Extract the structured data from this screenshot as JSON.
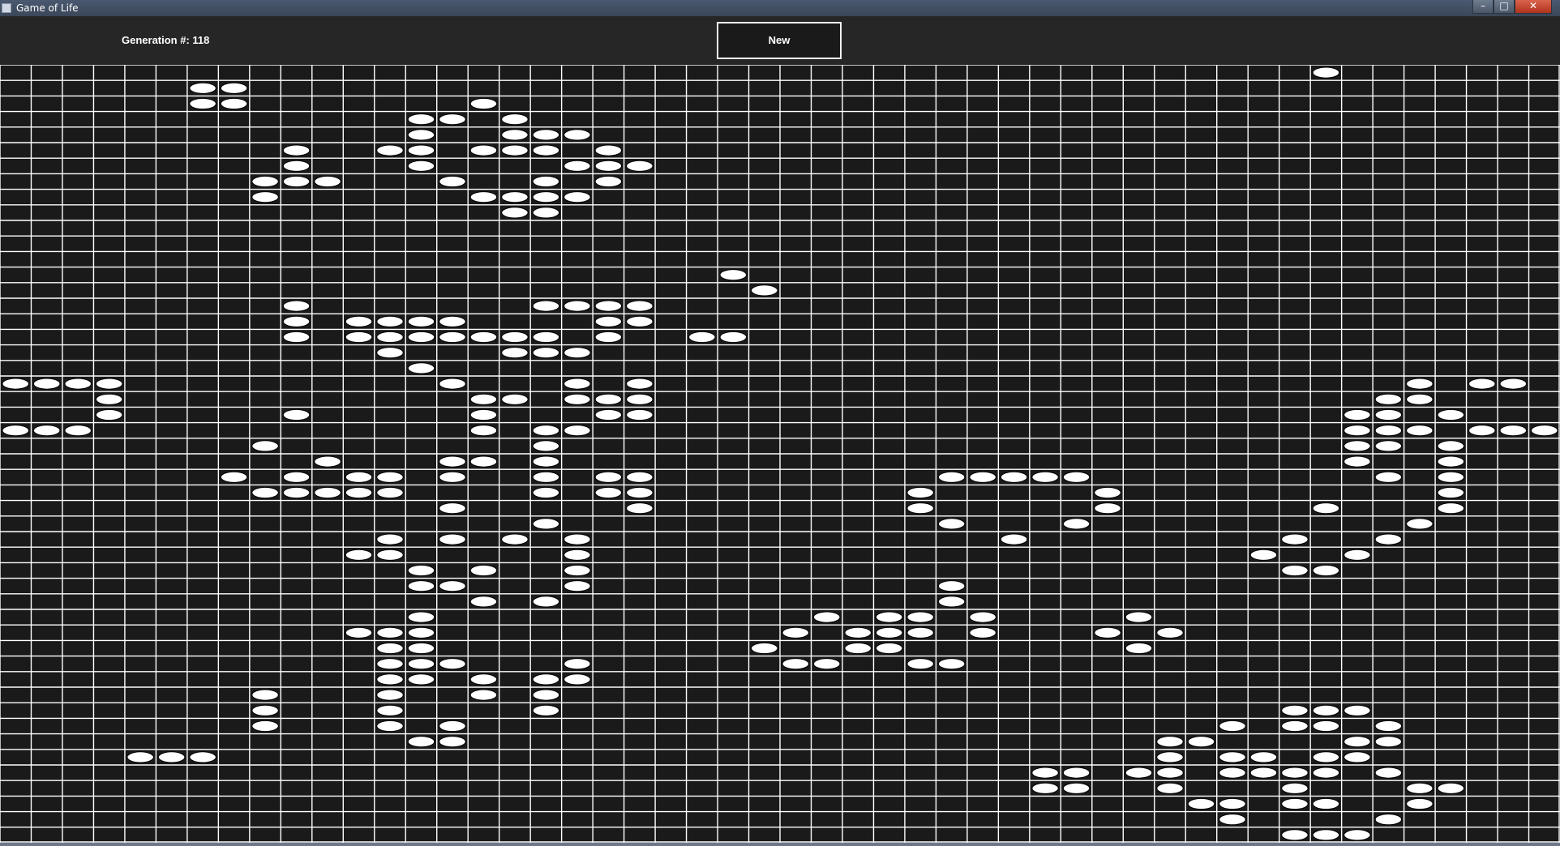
{
  "window": {
    "title": "Game of Life",
    "controls": {
      "minimize": "–",
      "maximize": "□",
      "close": "✕"
    }
  },
  "toolbar": {
    "generation_label": "Generation #: 118",
    "new_button_label": "New"
  },
  "board": {
    "columns": 50,
    "rows": 50,
    "background_color": "#1a1a1a",
    "grid_color": "#ffffff",
    "live_cell_color": "#ffffff",
    "live_cells": [
      [
        0,
        42
      ],
      [
        1,
        6
      ],
      [
        1,
        7
      ],
      [
        2,
        6
      ],
      [
        2,
        7
      ],
      [
        2,
        15
      ],
      [
        3,
        13
      ],
      [
        3,
        14
      ],
      [
        3,
        16
      ],
      [
        4,
        13
      ],
      [
        4,
        16
      ],
      [
        4,
        17
      ],
      [
        4,
        18
      ],
      [
        5,
        9
      ],
      [
        5,
        12
      ],
      [
        5,
        13
      ],
      [
        5,
        15
      ],
      [
        5,
        16
      ],
      [
        5,
        17
      ],
      [
        5,
        19
      ],
      [
        6,
        9
      ],
      [
        6,
        13
      ],
      [
        6,
        18
      ],
      [
        6,
        19
      ],
      [
        6,
        20
      ],
      [
        7,
        8
      ],
      [
        7,
        9
      ],
      [
        7,
        10
      ],
      [
        7,
        14
      ],
      [
        7,
        17
      ],
      [
        7,
        19
      ],
      [
        8,
        8
      ],
      [
        8,
        15
      ],
      [
        8,
        16
      ],
      [
        8,
        17
      ],
      [
        8,
        18
      ],
      [
        9,
        16
      ],
      [
        9,
        17
      ],
      [
        13,
        23
      ],
      [
        14,
        24
      ],
      [
        15,
        9
      ],
      [
        15,
        17
      ],
      [
        15,
        18
      ],
      [
        15,
        19
      ],
      [
        15,
        20
      ],
      [
        16,
        9
      ],
      [
        16,
        11
      ],
      [
        16,
        12
      ],
      [
        16,
        13
      ],
      [
        16,
        14
      ],
      [
        16,
        19
      ],
      [
        16,
        20
      ],
      [
        17,
        9
      ],
      [
        17,
        11
      ],
      [
        17,
        12
      ],
      [
        17,
        13
      ],
      [
        17,
        14
      ],
      [
        17,
        15
      ],
      [
        17,
        16
      ],
      [
        17,
        17
      ],
      [
        17,
        19
      ],
      [
        17,
        22
      ],
      [
        17,
        23
      ],
      [
        18,
        12
      ],
      [
        18,
        16
      ],
      [
        18,
        17
      ],
      [
        18,
        18
      ],
      [
        19,
        13
      ],
      [
        20,
        0
      ],
      [
        20,
        1
      ],
      [
        20,
        2
      ],
      [
        20,
        3
      ],
      [
        20,
        14
      ],
      [
        20,
        18
      ],
      [
        20,
        20
      ],
      [
        20,
        45
      ],
      [
        20,
        47
      ],
      [
        20,
        48
      ],
      [
        21,
        3
      ],
      [
        21,
        15
      ],
      [
        21,
        16
      ],
      [
        21,
        18
      ],
      [
        21,
        19
      ],
      [
        21,
        20
      ],
      [
        21,
        44
      ],
      [
        21,
        45
      ],
      [
        22,
        3
      ],
      [
        22,
        9
      ],
      [
        22,
        15
      ],
      [
        22,
        19
      ],
      [
        22,
        20
      ],
      [
        22,
        43
      ],
      [
        22,
        44
      ],
      [
        22,
        46
      ],
      [
        23,
        0
      ],
      [
        23,
        1
      ],
      [
        23,
        2
      ],
      [
        23,
        15
      ],
      [
        23,
        17
      ],
      [
        23,
        18
      ],
      [
        23,
        43
      ],
      [
        23,
        44
      ],
      [
        23,
        45
      ],
      [
        23,
        47
      ],
      [
        23,
        48
      ],
      [
        23,
        49
      ],
      [
        24,
        8
      ],
      [
        24,
        17
      ],
      [
        24,
        43
      ],
      [
        24,
        44
      ],
      [
        24,
        46
      ],
      [
        25,
        10
      ],
      [
        25,
        14
      ],
      [
        25,
        15
      ],
      [
        25,
        17
      ],
      [
        25,
        43
      ],
      [
        25,
        46
      ],
      [
        26,
        7
      ],
      [
        26,
        9
      ],
      [
        26,
        11
      ],
      [
        26,
        12
      ],
      [
        26,
        14
      ],
      [
        26,
        17
      ],
      [
        26,
        19
      ],
      [
        26,
        20
      ],
      [
        26,
        30
      ],
      [
        26,
        31
      ],
      [
        26,
        32
      ],
      [
        26,
        33
      ],
      [
        26,
        34
      ],
      [
        26,
        44
      ],
      [
        26,
        46
      ],
      [
        27,
        8
      ],
      [
        27,
        9
      ],
      [
        27,
        10
      ],
      [
        27,
        11
      ],
      [
        27,
        12
      ],
      [
        27,
        17
      ],
      [
        27,
        19
      ],
      [
        27,
        20
      ],
      [
        27,
        29
      ],
      [
        27,
        35
      ],
      [
        27,
        46
      ],
      [
        28,
        14
      ],
      [
        28,
        20
      ],
      [
        28,
        29
      ],
      [
        28,
        35
      ],
      [
        28,
        42
      ],
      [
        28,
        46
      ],
      [
        29,
        17
      ],
      [
        29,
        30
      ],
      [
        29,
        34
      ],
      [
        29,
        45
      ],
      [
        30,
        12
      ],
      [
        30,
        14
      ],
      [
        30,
        16
      ],
      [
        30,
        18
      ],
      [
        30,
        32
      ],
      [
        30,
        41
      ],
      [
        30,
        44
      ],
      [
        31,
        11
      ],
      [
        31,
        12
      ],
      [
        31,
        18
      ],
      [
        31,
        40
      ],
      [
        31,
        43
      ],
      [
        32,
        13
      ],
      [
        32,
        15
      ],
      [
        32,
        18
      ],
      [
        32,
        41
      ],
      [
        32,
        42
      ],
      [
        33,
        13
      ],
      [
        33,
        14
      ],
      [
        33,
        18
      ],
      [
        33,
        30
      ],
      [
        34,
        15
      ],
      [
        34,
        17
      ],
      [
        34,
        30
      ],
      [
        35,
        13
      ],
      [
        35,
        26
      ],
      [
        35,
        28
      ],
      [
        35,
        29
      ],
      [
        35,
        31
      ],
      [
        35,
        36
      ],
      [
        36,
        11
      ],
      [
        36,
        12
      ],
      [
        36,
        13
      ],
      [
        36,
        25
      ],
      [
        36,
        27
      ],
      [
        36,
        28
      ],
      [
        36,
        29
      ],
      [
        36,
        31
      ],
      [
        36,
        35
      ],
      [
        36,
        37
      ],
      [
        37,
        12
      ],
      [
        37,
        13
      ],
      [
        37,
        24
      ],
      [
        37,
        27
      ],
      [
        37,
        28
      ],
      [
        37,
        36
      ],
      [
        38,
        12
      ],
      [
        38,
        13
      ],
      [
        38,
        14
      ],
      [
        38,
        18
      ],
      [
        38,
        25
      ],
      [
        38,
        26
      ],
      [
        38,
        29
      ],
      [
        38,
        30
      ],
      [
        39,
        12
      ],
      [
        39,
        13
      ],
      [
        39,
        15
      ],
      [
        39,
        17
      ],
      [
        39,
        18
      ],
      [
        40,
        8
      ],
      [
        40,
        12
      ],
      [
        40,
        15
      ],
      [
        40,
        17
      ],
      [
        41,
        8
      ],
      [
        41,
        12
      ],
      [
        41,
        17
      ],
      [
        41,
        41
      ],
      [
        41,
        42
      ],
      [
        41,
        43
      ],
      [
        42,
        8
      ],
      [
        42,
        12
      ],
      [
        42,
        14
      ],
      [
        42,
        39
      ],
      [
        42,
        41
      ],
      [
        42,
        42
      ],
      [
        42,
        44
      ],
      [
        43,
        13
      ],
      [
        43,
        14
      ],
      [
        43,
        37
      ],
      [
        43,
        38
      ],
      [
        43,
        43
      ],
      [
        43,
        44
      ],
      [
        44,
        4
      ],
      [
        44,
        5
      ],
      [
        44,
        6
      ],
      [
        44,
        37
      ],
      [
        44,
        39
      ],
      [
        44,
        40
      ],
      [
        44,
        42
      ],
      [
        44,
        43
      ],
      [
        45,
        33
      ],
      [
        45,
        34
      ],
      [
        45,
        36
      ],
      [
        45,
        37
      ],
      [
        45,
        39
      ],
      [
        45,
        40
      ],
      [
        45,
        41
      ],
      [
        45,
        42
      ],
      [
        45,
        44
      ],
      [
        46,
        33
      ],
      [
        46,
        34
      ],
      [
        46,
        37
      ],
      [
        46,
        41
      ],
      [
        46,
        45
      ],
      [
        46,
        46
      ],
      [
        47,
        38
      ],
      [
        47,
        39
      ],
      [
        47,
        41
      ],
      [
        47,
        42
      ],
      [
        47,
        45
      ],
      [
        48,
        39
      ],
      [
        48,
        44
      ],
      [
        49,
        41
      ],
      [
        49,
        42
      ],
      [
        49,
        43
      ]
    ]
  }
}
